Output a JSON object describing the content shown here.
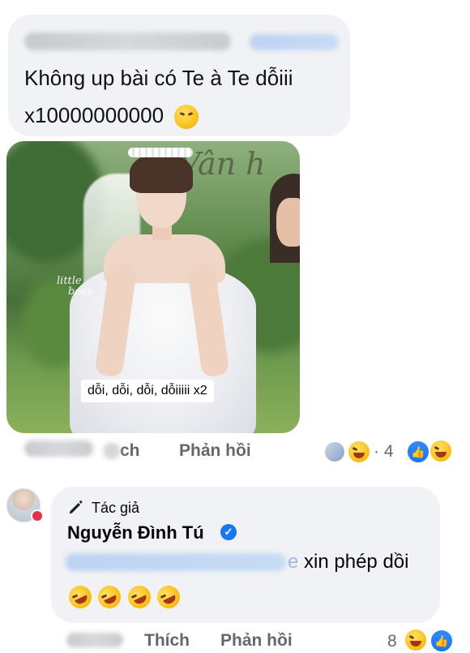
{
  "comment1": {
    "text_line1": "Không up bài có Te à Te dỗiii",
    "text_line2": "x10000000000",
    "emoji": "face-with-steam-emoji"
  },
  "photo": {
    "caption": "dỗi, dỗi, dỗi, dỗiiiii x2",
    "watermark_script": "Vân h",
    "logo_line1": "little",
    "logo_line2": "boss"
  },
  "comment1_actions": {
    "like_fragment": "ch",
    "reply_label": "Phản hồi",
    "reaction_count": "· 4",
    "reaction_icons": [
      "avatar",
      "laughing-emoji",
      "like-icon",
      "laughing-emoji"
    ]
  },
  "reply": {
    "author_tag": "Tác giả",
    "author_name": "Nguyễn Đình Tú",
    "verified_icon": "verified-badge-icon",
    "text": "xin phép dồi",
    "emojis": [
      "rofl-emoji",
      "rofl-emoji",
      "rofl-emoji",
      "rofl-emoji"
    ]
  },
  "reply_actions": {
    "time_fragment": "ọ.c",
    "like_label": "Thích",
    "reply_label": "Phản hồi",
    "reaction_count": "8"
  },
  "colors": {
    "bubble": "#f0f2f5",
    "secondary_text": "#65676b",
    "facebook_blue": "#1877f2"
  }
}
